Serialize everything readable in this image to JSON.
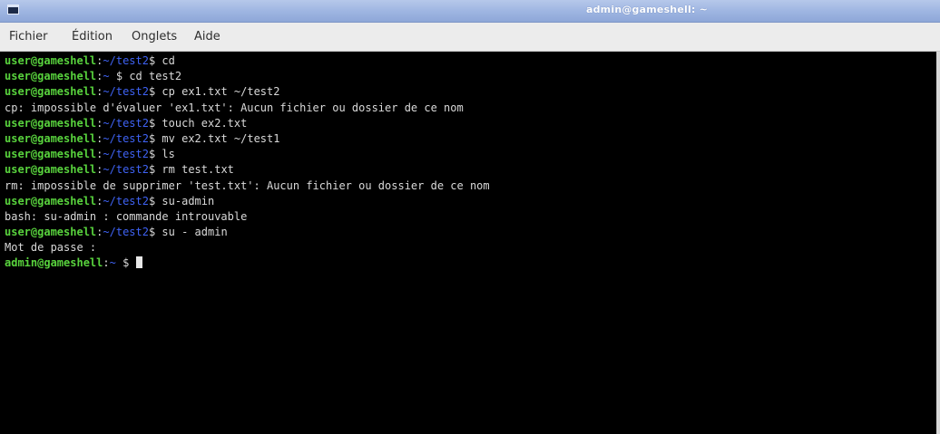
{
  "window": {
    "title": "admin@gameshell: ~"
  },
  "menu": {
    "items": [
      "Fichier",
      "Édition",
      "Onglets",
      "Aide"
    ]
  },
  "colors": {
    "titlebar": "#9fb6e2",
    "prompt_user": "#58d23d",
    "prompt_path": "#3f63f5",
    "terminal_bg": "#000000",
    "terminal_fg": "#d9d9d9"
  },
  "terminal": {
    "lines": [
      {
        "type": "prompt",
        "user": "user@gameshell",
        "sep": ":",
        "path": "~/test2",
        "symbol": "$ ",
        "cmd": "cd"
      },
      {
        "type": "prompt",
        "user": "user@gameshell",
        "sep": ":",
        "path": "~",
        "symbol": " $ ",
        "cmd": "cd test2"
      },
      {
        "type": "prompt",
        "user": "user@gameshell",
        "sep": ":",
        "path": "~/test2",
        "symbol": "$ ",
        "cmd": "cp ex1.txt ~/test2"
      },
      {
        "type": "output",
        "text": "cp: impossible d'évaluer 'ex1.txt': Aucun fichier ou dossier de ce nom"
      },
      {
        "type": "prompt",
        "user": "user@gameshell",
        "sep": ":",
        "path": "~/test2",
        "symbol": "$ ",
        "cmd": "touch ex2.txt"
      },
      {
        "type": "prompt",
        "user": "user@gameshell",
        "sep": ":",
        "path": "~/test2",
        "symbol": "$ ",
        "cmd": "mv ex2.txt ~/test1"
      },
      {
        "type": "prompt",
        "user": "user@gameshell",
        "sep": ":",
        "path": "~/test2",
        "symbol": "$ ",
        "cmd": "ls"
      },
      {
        "type": "prompt",
        "user": "user@gameshell",
        "sep": ":",
        "path": "~/test2",
        "symbol": "$ ",
        "cmd": "rm test.txt"
      },
      {
        "type": "output",
        "text": "rm: impossible de supprimer 'test.txt': Aucun fichier ou dossier de ce nom"
      },
      {
        "type": "prompt",
        "user": "user@gameshell",
        "sep": ":",
        "path": "~/test2",
        "symbol": "$ ",
        "cmd": "su-admin"
      },
      {
        "type": "output",
        "text": "bash: su-admin : commande introuvable"
      },
      {
        "type": "prompt",
        "user": "user@gameshell",
        "sep": ":",
        "path": "~/test2",
        "symbol": "$ ",
        "cmd": "su - admin"
      },
      {
        "type": "output",
        "text": "Mot de passe :"
      },
      {
        "type": "prompt",
        "user": "admin@gameshell",
        "sep": ":",
        "path": "~",
        "symbol": " $ ",
        "cmd": ""
      }
    ]
  }
}
